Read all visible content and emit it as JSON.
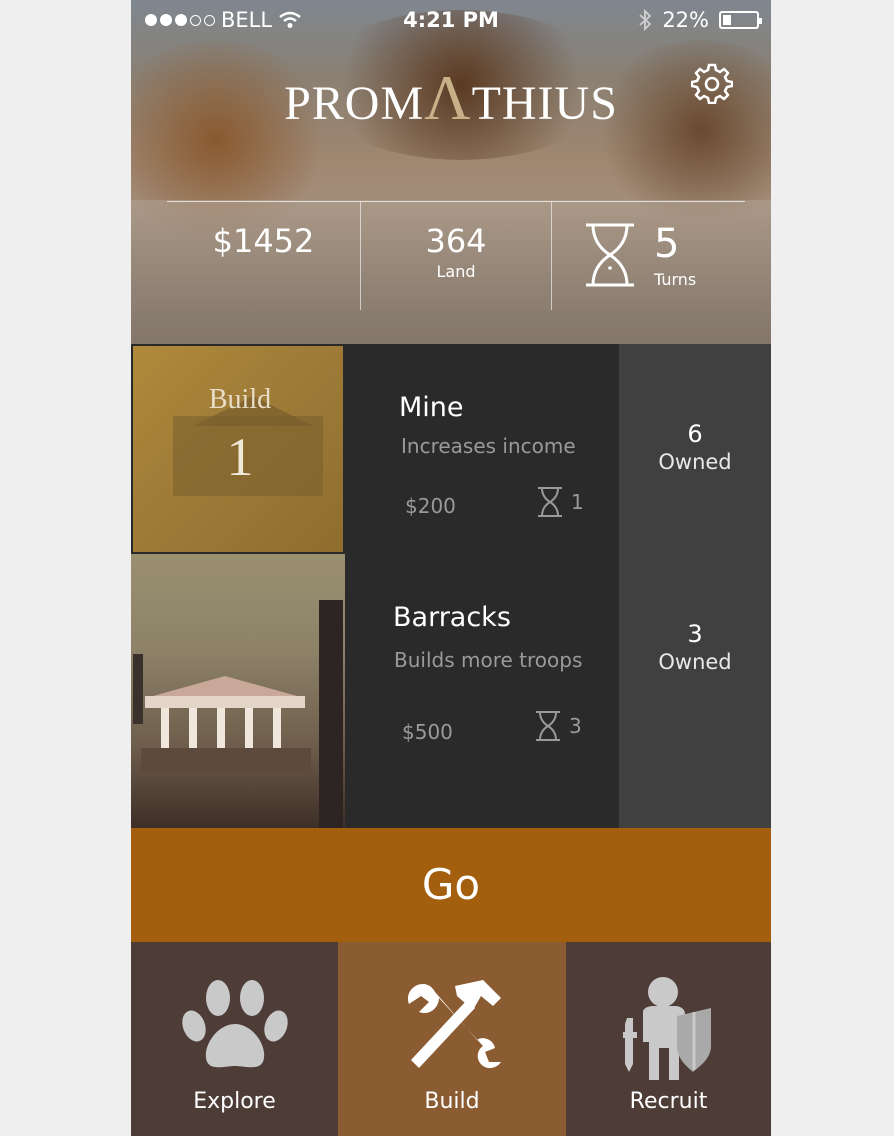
{
  "status_bar": {
    "carrier": "BELL",
    "time": "4:21 PM",
    "battery": "22%",
    "signal_bars_filled": 3,
    "battery_level": 0.22
  },
  "header": {
    "title_left": "PROM",
    "title_lambda": "Λ",
    "title_right": "THIUS",
    "settings_icon": "gear-icon"
  },
  "stats": {
    "money": "$1452",
    "land_value": "364",
    "land_label": "Land",
    "turns_value": "5",
    "turns_label": "Turns",
    "turns_icon": "hourglass-icon"
  },
  "items": [
    {
      "thumb_label": "Build",
      "thumb_number": "1",
      "name": "Mine",
      "description": "Increases income",
      "price": "$200",
      "turns": "1",
      "owned_count": "6",
      "owned_label": "Owned"
    },
    {
      "name": "Barracks",
      "description": "Builds more troops",
      "price": "$500",
      "turns": "3",
      "owned_count": "3",
      "owned_label": "Owned"
    }
  ],
  "go_button": "Go",
  "nav": [
    {
      "label": "Explore",
      "icon": "paw-icon"
    },
    {
      "label": "Build",
      "icon": "tools-icon",
      "active": true
    },
    {
      "label": "Recruit",
      "icon": "soldier-icon"
    }
  ],
  "colors": {
    "go": "#a35e0e",
    "nav_bg": "#4e3c37",
    "nav_active": "#8b5c32",
    "owned_bg": "#404040",
    "info_bg": "#2a2a2a"
  }
}
